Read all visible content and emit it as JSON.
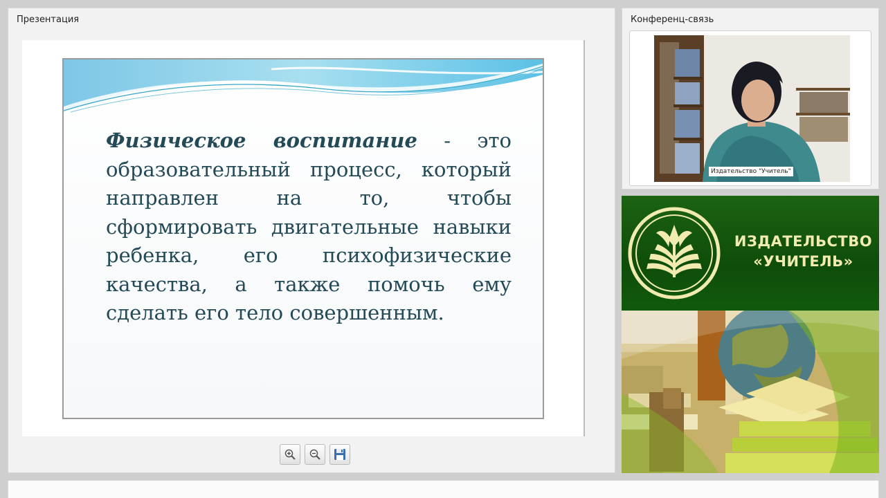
{
  "presentation_panel": {
    "title": "Презентация"
  },
  "conference_panel": {
    "title": "Конференц-связь",
    "video_label": "Издательство \"Учитель\""
  },
  "slide": {
    "term": "Физическое воспитание",
    "body": "- это образовательный процесс, который направлен на то, чтобы сформировать двигательные навыки ребенка, его психофизические качества, а также помочь ему сделать его тело совершенным."
  },
  "toolbar": {
    "icons": [
      "zoom-in-icon",
      "zoom-out-icon",
      "save-icon"
    ]
  },
  "publisher": {
    "line1": "ИЗДАТЕЛЬСТВО",
    "line2": "«УЧИТЕЛЬ»"
  },
  "colors": {
    "brand_green": "#1c6312",
    "brand_text": "#f2ebb0",
    "slide_text": "#234a56"
  }
}
